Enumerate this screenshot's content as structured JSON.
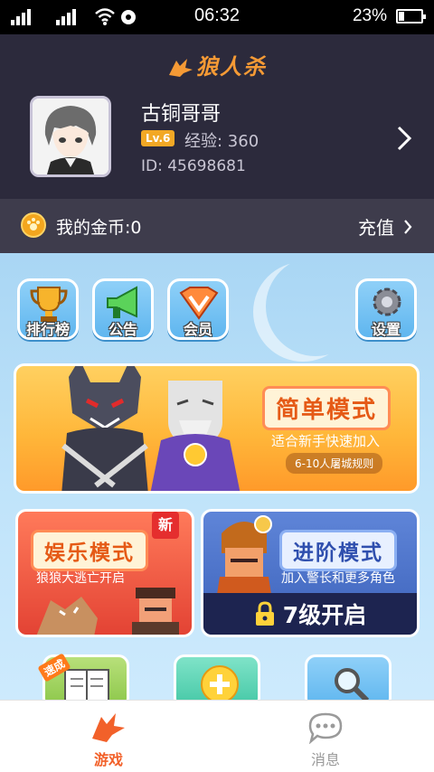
{
  "status_bar": {
    "time": "06:32",
    "battery_percent": "23%",
    "battery_level": 0.23
  },
  "header": {
    "app_title": "狼人杀"
  },
  "profile": {
    "name": "古铜哥哥",
    "level": "Lv.6",
    "experience": "经验: 360",
    "id": "ID: 45698681"
  },
  "coins": {
    "label": "我的金币:0",
    "recharge_label": "充值"
  },
  "shortcuts": [
    {
      "label": "排行榜",
      "icon": "trophy-icon"
    },
    {
      "label": "公告",
      "icon": "megaphone-icon"
    },
    {
      "label": "会员",
      "icon": "vip-icon"
    },
    {
      "label": "设置",
      "icon": "gear-icon"
    }
  ],
  "modes": {
    "easy": {
      "title": "简单模式",
      "subtitle": "适合新手快速加入",
      "rule": "6-10人屠城规则"
    },
    "fun": {
      "title": "娱乐模式",
      "subtitle": "狼狼大逃亡开启",
      "badge": "新"
    },
    "advanced": {
      "title": "进阶模式",
      "subtitle": "加入警长和更多角色",
      "unlock": "7级开启"
    }
  },
  "more_cards": [
    {
      "icon": "book-icon",
      "badge": "速成"
    },
    {
      "icon": "plus-icon"
    },
    {
      "icon": "magnifier-icon"
    }
  ],
  "tab_bar": {
    "tabs": [
      {
        "label": "游戏",
        "icon": "wolf-icon",
        "active": true
      },
      {
        "label": "消息",
        "icon": "chat-bubble-icon",
        "active": false
      }
    ],
    "active_color": "#f2612a",
    "inactive_color": "#9a9a9a"
  }
}
